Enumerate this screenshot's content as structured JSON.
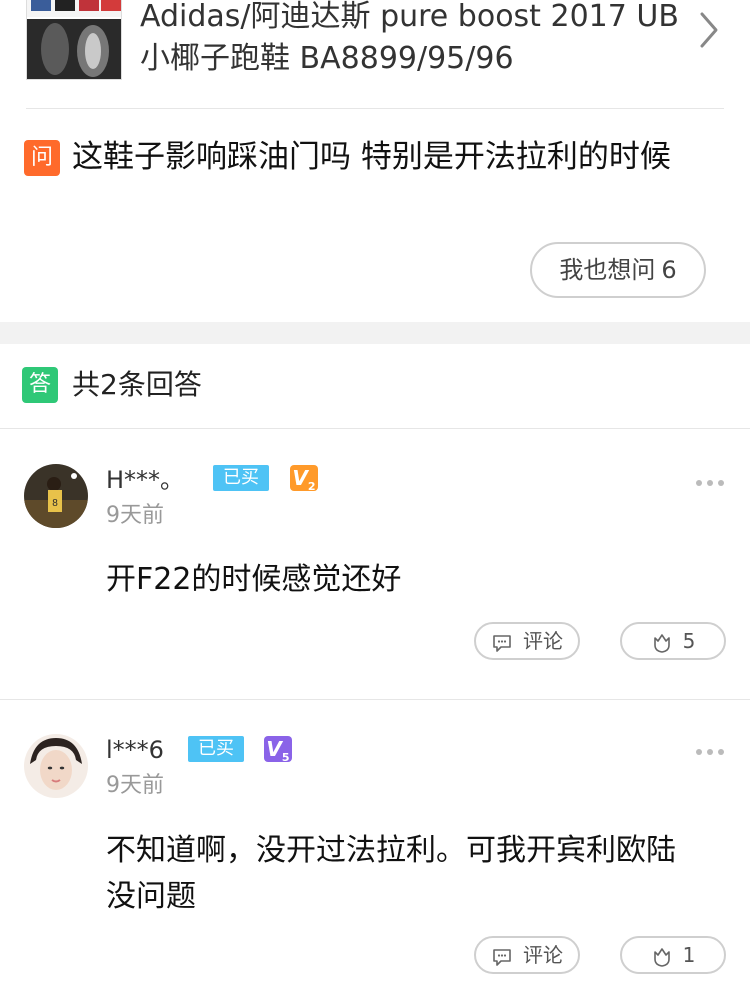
{
  "product": {
    "title": "Adidas/阿迪达斯 pure boost 2017 UB小椰子跑鞋 BA8899/95/96"
  },
  "question": {
    "badge": "问",
    "text": "这鞋子影响踩油门吗 特别是开法拉利的时候",
    "ask_too_label": "我也想问",
    "ask_too_count": "6"
  },
  "answers_header": {
    "badge": "答",
    "count_label": "共2条回答"
  },
  "answers": [
    {
      "user": "H***。",
      "bought": "已买",
      "vip_level": "2",
      "time": "9天前",
      "text": "开F22的时候感觉还好",
      "comment_label": "评论",
      "likes": "5"
    },
    {
      "user": "l***6",
      "bought": "已买",
      "vip_level": "5",
      "time": "9天前",
      "text": "不知道啊，没开过法拉利。可我开宾利欧陆没问题",
      "comment_label": "评论",
      "likes": "1"
    }
  ],
  "colors": {
    "question_badge": "#ff6a2b",
    "answer_badge": "#2fc877",
    "bought_badge": "#4ec3f5",
    "vip2": "#ff9a2a",
    "vip5": "#8a63e8"
  }
}
